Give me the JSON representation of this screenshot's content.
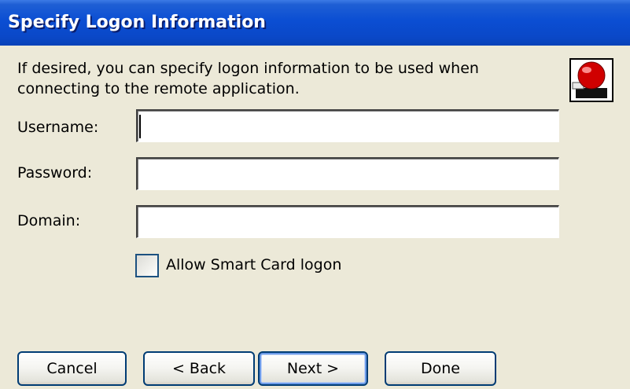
{
  "dialog": {
    "title": "Specify Logon Information",
    "description": "If desired, you can specify logon information to be used when connecting to the remote application.",
    "icon": "server-icon"
  },
  "form": {
    "username_label": "Username:",
    "username_value": "",
    "password_label": "Password:",
    "password_value": "",
    "domain_label": "Domain:",
    "domain_value": "",
    "smartcard_label": "Allow Smart Card logon",
    "smartcard_checked": false
  },
  "buttons": {
    "cancel": "Cancel",
    "back": "< Back",
    "next": "Next >",
    "done": "Done"
  },
  "colors": {
    "titlebar": "#0b4ed3",
    "background": "#ece9d8",
    "button_border": "#003c74"
  }
}
